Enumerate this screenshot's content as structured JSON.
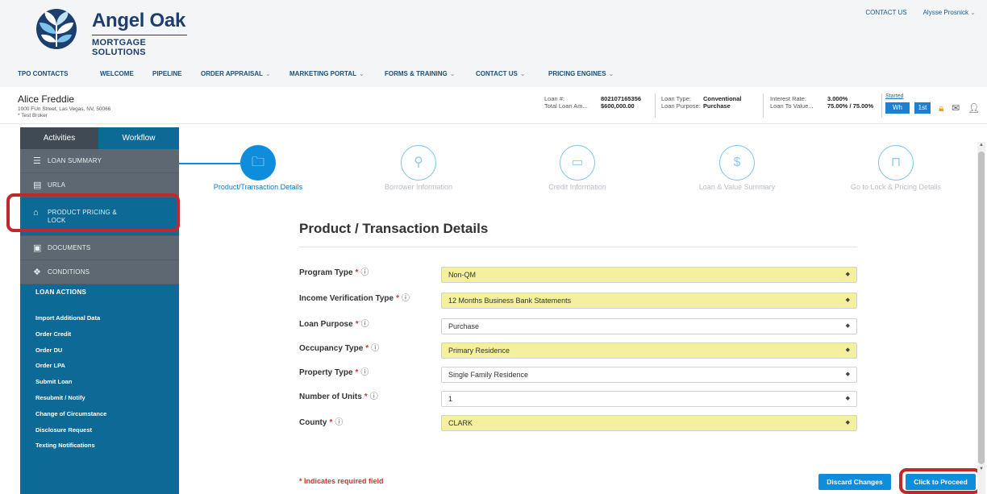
{
  "brand": {
    "name_line1": "Angel Oak",
    "name_line2": "MORTGAGE SOLUTIONS",
    "primary_color": "#1d3f6e",
    "accent_color": "#0d8ddb"
  },
  "top_links": {
    "contact_us": "CONTACT US",
    "user": "Alysse Prosnick"
  },
  "nav": {
    "items": [
      {
        "label": "TPO CONTACTS",
        "dropdown": false
      },
      {
        "label": "WELCOME",
        "dropdown": false
      },
      {
        "label": "PIPELINE",
        "dropdown": false
      },
      {
        "label": "ORDER APPRAISAL",
        "dropdown": true
      },
      {
        "label": "MARKETING PORTAL",
        "dropdown": true
      },
      {
        "label": "FORMS & TRAINING",
        "dropdown": true
      },
      {
        "label": "CONTACT US",
        "dropdown": true
      },
      {
        "label": "PRICING ENGINES",
        "dropdown": true
      }
    ]
  },
  "loan": {
    "borrower_name": "Alice Freddie",
    "address": "1000 FUn Street, Las Vegas, NV, 50066",
    "broker": "* Test Broker",
    "loan_number_label": "Loan #:",
    "loan_number": "802107165356",
    "total_loan_label": "Total Loan Am...",
    "total_loan": "$600,000.00",
    "loan_type_label": "Loan Type:",
    "loan_type": "Conventional",
    "loan_purpose_label": "Loan Purpose:",
    "loan_purpose": "Purchase",
    "interest_rate_label": "Interest Rate:",
    "interest_rate": "3.000%",
    "ltv_label": "Loan To Value...",
    "ltv": "75.00% / 75.00%",
    "status": "Started",
    "btn_wh": "Wh",
    "btn_1st": "1st"
  },
  "sidebar": {
    "tab_activities": "Activities",
    "tab_workflow": "Workflow",
    "menu": [
      {
        "label": "LOAN SUMMARY",
        "icon": "list-icon"
      },
      {
        "label": "URLA",
        "icon": "form-icon"
      },
      {
        "label": "PRODUCT PRICING & LOCK",
        "icon": "lock-icon"
      },
      {
        "label": "DOCUMENTS",
        "icon": "document-icon"
      },
      {
        "label": "CONDITIONS",
        "icon": "conditions-icon"
      }
    ],
    "loan_actions_title": "LOAN ACTIONS",
    "loan_actions": [
      "Import Additional Data",
      "Order Credit",
      "Order DU",
      "Order LPA",
      "Submit Loan",
      "Resubmit / Notify",
      "Change of Circumstance",
      "Disclosure Request",
      "Texting Notifications"
    ]
  },
  "steps": [
    {
      "label": "Product/Transaction Details",
      "icon": "folder-icon",
      "current": true
    },
    {
      "label": "Borrower Information",
      "icon": "person-icon",
      "current": false
    },
    {
      "label": "Credit Information",
      "icon": "credit-card-icon",
      "current": false
    },
    {
      "label": "Loan & Value Summary",
      "icon": "dollar-icon",
      "current": false
    },
    {
      "label": "Go to Lock & Pricing Details",
      "icon": "lock-icon",
      "current": false
    }
  ],
  "form": {
    "title": "Product / Transaction Details",
    "required_mark": "*",
    "info_mark": "ⓘ",
    "fields": [
      {
        "label": "Program Type",
        "value": "Non-QM",
        "highlighted": true
      },
      {
        "label": "Income Verification Type",
        "value": "12 Months Business Bank Statements",
        "highlighted": true
      },
      {
        "label": "Loan Purpose",
        "value": "Purchase",
        "highlighted": false
      },
      {
        "label": "Occupancy Type",
        "value": "Primary Residence",
        "highlighted": true
      },
      {
        "label": "Property Type",
        "value": "Single Family Residence",
        "highlighted": false
      },
      {
        "label": "Number of Units",
        "value": "1",
        "highlighted": false
      },
      {
        "label": "County",
        "value": "CLARK",
        "highlighted": true
      }
    ],
    "required_note": "* Indicates required field",
    "discard_label": "Discard Changes",
    "proceed_label": "Click to Proceed"
  }
}
